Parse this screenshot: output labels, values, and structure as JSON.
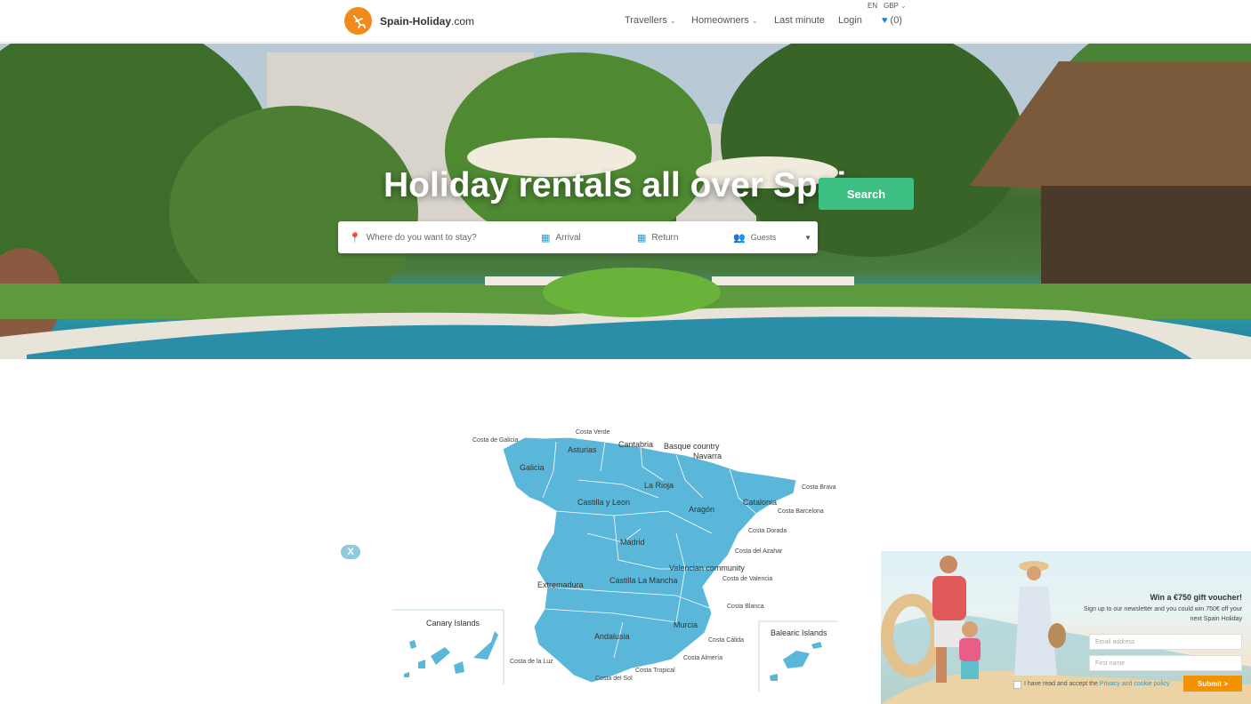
{
  "header": {
    "brand_bold": "Spain-Holiday",
    "brand_suffix": ".com",
    "lang": "EN",
    "currency": "GBP",
    "nav": {
      "travellers": "Travellers",
      "homeowners": "Homeowners",
      "last_minute": "Last minute",
      "login": "Login",
      "favourites_count": "(0)"
    }
  },
  "hero": {
    "title": "Holiday rentals all over Spain",
    "search": {
      "destination_placeholder": "Where do you want to stay?",
      "arrival_placeholder": "Arrival",
      "return_placeholder": "Return",
      "guests_label": "Guests",
      "button": "Search"
    }
  },
  "map": {
    "fill_color": "#5ab7da",
    "regions": {
      "galicia": "Galicia",
      "asturias": "Asturias",
      "cantabria": "Cantabria",
      "basque": "Basque country",
      "navarra": "Navarra",
      "rioja": "La Rioja",
      "castilla_leon": "Castilla y Leon",
      "aragon": "Aragón",
      "catalonia": "Catalonia",
      "madrid": "Madrid",
      "valencian": "Valencian community",
      "extremadura": "Extremadura",
      "castilla_mancha": "Castilla La Mancha",
      "andalusia": "Andalusia",
      "murcia": "Murcia",
      "canary": "Canary Islands",
      "balearic": "Balearic Islands"
    },
    "coasts": {
      "verde": "Costa Verde",
      "galicia": "Costa de Galicia",
      "brava": "Costa Brava",
      "barcelona": "Costa Barcelona",
      "dorada": "Costa Dorada",
      "azahar": "Costa del Azahar",
      "valencia": "Costa de Valencia",
      "blanca": "Costa Blanca",
      "calida": "Costa Cálida",
      "almeria": "Costa Almería",
      "tropical": "Costa Tropical",
      "sol": "Costa del Sol",
      "luz": "Costa de la Luz"
    }
  },
  "popup": {
    "close": "X",
    "title": "Win a €750 gift voucher!",
    "subtitle_1": "Sign up to our newsletter and you could win 750€ off your",
    "subtitle_2": "next Spain Holiday",
    "email_placeholder": "Email address",
    "name_placeholder": "First name",
    "consent_text": "I have read and accept the ",
    "consent_link": "Privacy and cookie policy",
    "submit": "Submit >"
  }
}
